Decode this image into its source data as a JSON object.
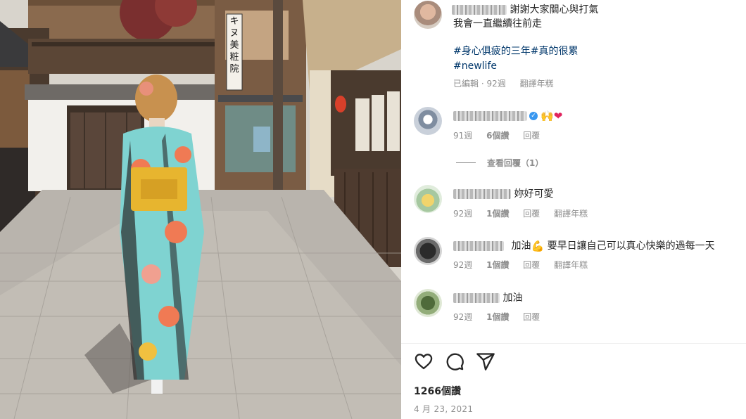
{
  "post": {
    "caption_line1": "謝謝大家關心與打氣",
    "caption_line2": "我會一直繼續往前走",
    "hashtag_line1": "#身心俱疲的三年#真的很累",
    "hashtag_line2": "#newlife",
    "edited_label": "已編輯",
    "age": "92週",
    "translate_label": "翻譯年糕"
  },
  "shop_sign": "キヌ美粧院",
  "comments": [
    {
      "text": "",
      "age": "91週",
      "likes": "6個讚",
      "reply_label": "回覆",
      "view_replies": "查看回覆（1）"
    },
    {
      "text": "妳好可愛",
      "age": "92週",
      "likes": "1個讚",
      "reply_label": "回覆",
      "translate_label": "翻譯年糕"
    },
    {
      "text_a": "加油",
      "text_b": "要早日讓自己可以真心快樂的過每一天",
      "age": "92週",
      "likes": "1個讚",
      "reply_label": "回覆",
      "translate_label": "翻譯年糕"
    },
    {
      "text": "加油",
      "age": "92週",
      "likes": "1個讚",
      "reply_label": "回覆"
    }
  ],
  "icons": [
    "heart-icon",
    "comment-icon",
    "share-icon",
    "verified-icon",
    "praise-hands-emoji",
    "red-heart-emoji",
    "flexed-biceps-emoji"
  ],
  "colors": {
    "hashtag": "#00376b",
    "meta": "#8e8e8e",
    "text": "#262626",
    "heart": "#e0245e"
  },
  "footer": {
    "likes_count": "1266個讚",
    "date": "4 月 23, 2021"
  }
}
